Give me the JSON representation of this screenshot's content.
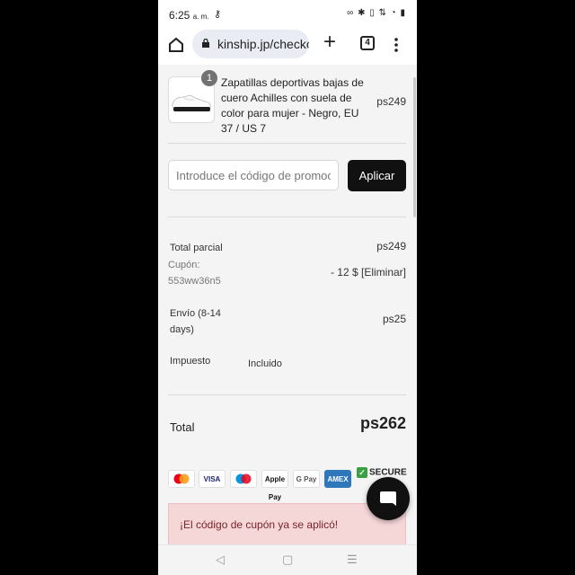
{
  "status_bar": {
    "time": "6:25",
    "ampm": "a. m."
  },
  "browser": {
    "url": "kinship.jp/checkout",
    "tab_count": "4"
  },
  "cart_item": {
    "quantity": "1",
    "name": "Zapatillas deportivas bajas de cuero Achilles con suela de color para mujer - Negro, EU 37 / US 7",
    "price": "ps249"
  },
  "promo": {
    "placeholder": "Introduce el código de promoción",
    "apply_label": "Aplicar"
  },
  "summary": {
    "subtotal_label": "Total parcial",
    "subtotal_value": "ps249",
    "coupon_label": "Cupón:",
    "coupon_code": "553ww36n5",
    "coupon_value": "- 12 $ [Eliminar]",
    "shipping_label": "Envío (8-14 days)",
    "shipping_value": "ps25",
    "tax_label": "Impuesto",
    "tax_value": "Incluido",
    "total_label": "Total",
    "total_value": "ps262"
  },
  "payment_methods": [
    "mastercard-icon",
    "VISA",
    "maestro-icon",
    "Apple Pay",
    "G Pay",
    "AMEX"
  ],
  "secure_label": "SECURE",
  "alert": {
    "message": "¡El código de cupón ya se aplicó!"
  },
  "colors": {
    "accent": "#111111",
    "alert_bg": "#f6d7d8",
    "alert_text": "#7a2327"
  }
}
